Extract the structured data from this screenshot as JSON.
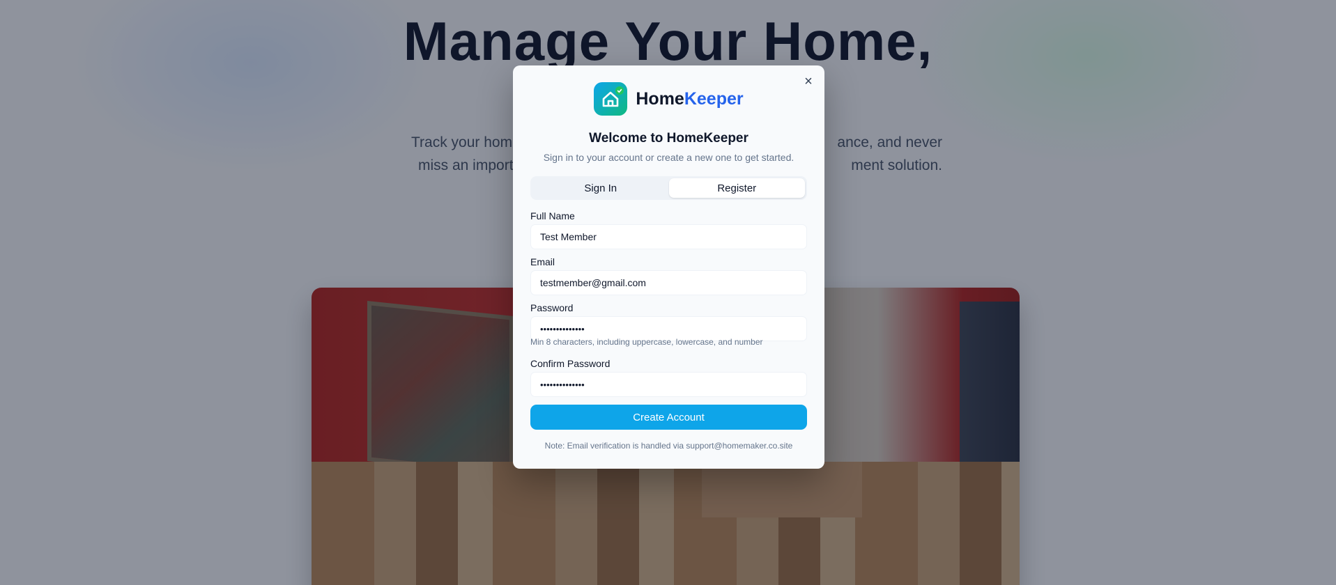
{
  "hero": {
    "title": "Manage Your Home,",
    "subtitle_line1": "Track your home",
    "subtitle_line1_end": "ance, and never",
    "subtitle_line2": "miss an importa",
    "subtitle_line2_end": "ment solution."
  },
  "modal": {
    "close_icon": "×",
    "brand_home": "Home",
    "brand_keeper": "Keeper",
    "title": "Welcome to HomeKeeper",
    "subtitle": "Sign in to your account or create a new one to get started.",
    "tabs": [
      {
        "label": "Sign In",
        "active": false
      },
      {
        "label": "Register",
        "active": true
      }
    ],
    "fields": {
      "full_name_label": "Full Name",
      "full_name_value": "Test Member",
      "email_label": "Email",
      "email_value": "testmember@gmail.com",
      "password_label": "Password",
      "password_value": "••••••••••••••",
      "password_hint": "Min 8 characters, including uppercase, lowercase, and number",
      "confirm_label": "Confirm Password",
      "confirm_value": "••••••••••••••"
    },
    "submit_label": "Create Account",
    "note": "Note: Email verification is handled via support@homemaker.co.site"
  },
  "colors": {
    "accent": "#0ea5e9",
    "brand_blue": "#2563eb",
    "logo_gradient_start": "#0ea5e9",
    "logo_gradient_end": "#10b981"
  },
  "icons": {
    "logo": "house-check-icon",
    "close": "close-icon"
  }
}
